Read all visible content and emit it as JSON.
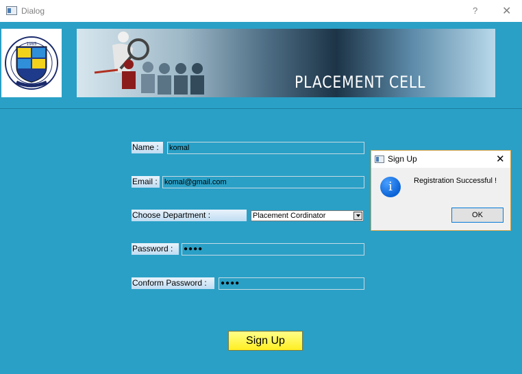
{
  "window": {
    "title": "Dialog",
    "help_label": "?",
    "close_label": "✕"
  },
  "header": {
    "banner_title": "PLACEMENT CELL",
    "logo_year": "1985"
  },
  "form": {
    "name_label": "Name :",
    "name_value": "komal",
    "email_label": "Email :",
    "email_value": "komal@gmail.com",
    "department_label": "Choose Department :",
    "department_value": "Placement Cordinator",
    "password_label": "Password :",
    "password_value": "●●●●",
    "confirm_label": "Conform Password :",
    "confirm_value": "●●●●",
    "signup_label": "Sign Up"
  },
  "message_box": {
    "title": "Sign Up",
    "close_label": "✕",
    "icon_glyph": "i",
    "text": "Registration Successful !",
    "ok_label": "OK"
  },
  "colors": {
    "background": "#2aa0c6",
    "signup_button": "#ffee22",
    "info_icon": "#0b63d6"
  }
}
